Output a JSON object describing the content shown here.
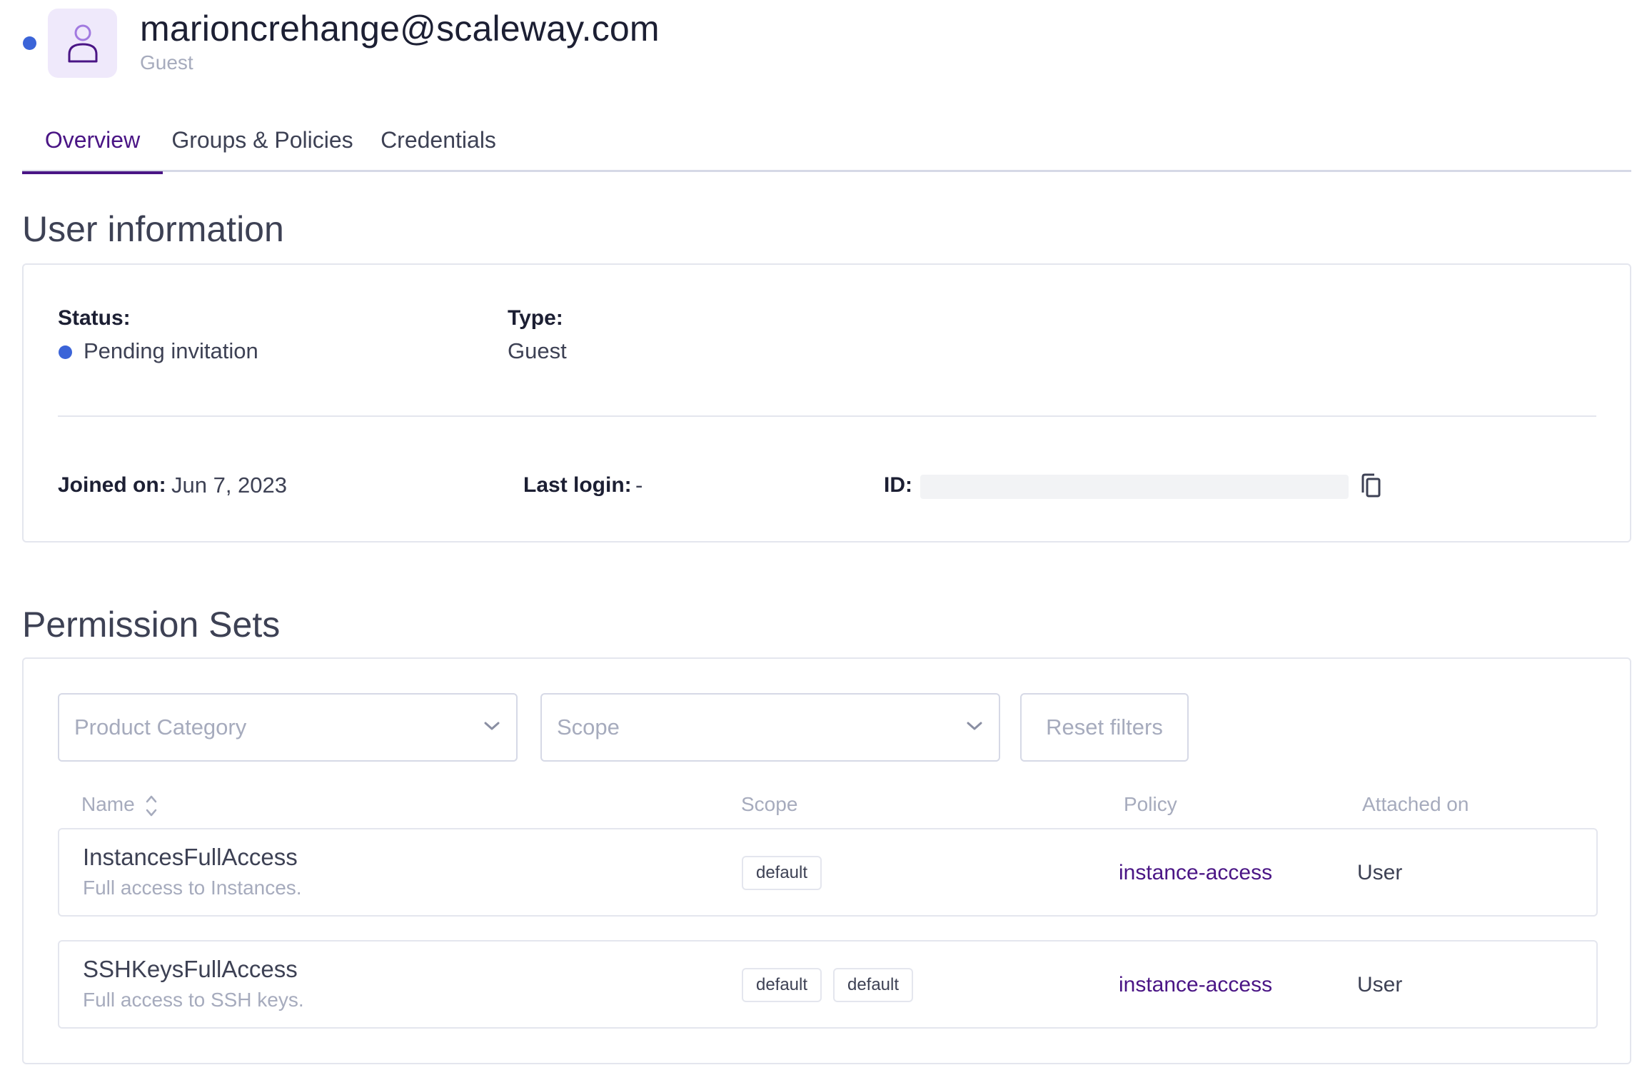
{
  "header": {
    "email": "marioncrehange@scaleway.com",
    "role": "Guest",
    "status_color": "#3b64d8",
    "avatar_icon": "user-icon"
  },
  "tabs": [
    {
      "label": "Overview",
      "active": true
    },
    {
      "label": "Groups & Policies",
      "active": false
    },
    {
      "label": "Credentials",
      "active": false
    }
  ],
  "user_info": {
    "title": "User information",
    "status_label": "Status:",
    "status_value": "Pending invitation",
    "type_label": "Type:",
    "type_value": "Guest",
    "joined_label": "Joined on:",
    "joined_value": "Jun 7, 2023",
    "last_login_label": "Last login:",
    "last_login_value": "-",
    "id_label": "ID:"
  },
  "permissions": {
    "title": "Permission Sets",
    "filters": {
      "product_category_placeholder": "Product Category",
      "scope_placeholder": "Scope",
      "reset_label": "Reset filters"
    },
    "columns": [
      "Name",
      "Scope",
      "Policy",
      "Attached on"
    ],
    "rows": [
      {
        "name": "InstancesFullAccess",
        "description": "Full access to Instances.",
        "scopes": [
          "default"
        ],
        "policy": "instance-access",
        "attached_on": "User"
      },
      {
        "name": "SSHKeysFullAccess",
        "description": "Full access to SSH keys.",
        "scopes": [
          "default",
          "default"
        ],
        "policy": "instance-access",
        "attached_on": "User"
      }
    ]
  },
  "colors": {
    "accent": "#4a1585",
    "status_blue": "#3b64d8",
    "muted": "#a6abbd"
  }
}
